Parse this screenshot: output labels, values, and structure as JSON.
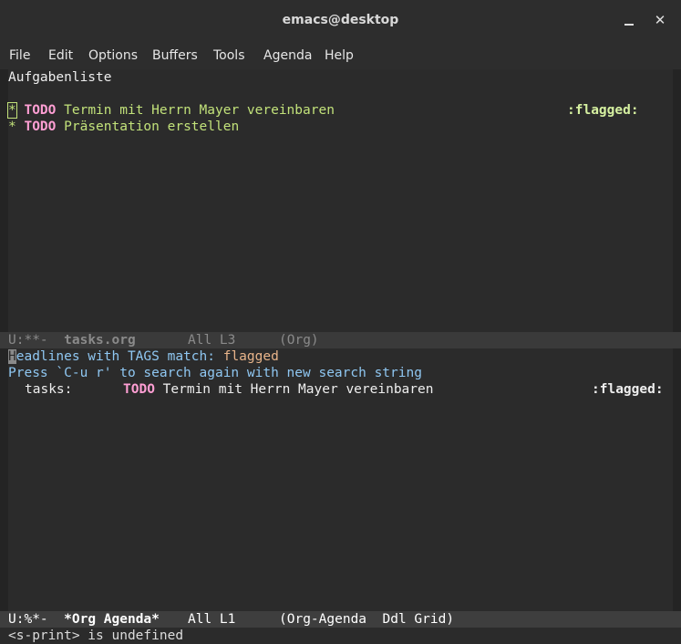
{
  "window": {
    "title": "emacs@desktop",
    "minimize_label": "",
    "close_label": "✕"
  },
  "menu": [
    "File",
    "Edit",
    "Options",
    "Buffers",
    "Tools",
    "Agenda",
    "Help"
  ],
  "top_buffer": {
    "heading": "Aufgabenliste",
    "items": [
      {
        "star": "*",
        "keyword": "TODO",
        "text": "Termin mit Herrn Mayer vereinbaren",
        "tag": ":flagged:"
      },
      {
        "star": "*",
        "keyword": "TODO",
        "text": "Präsentation erstellen",
        "tag": ""
      }
    ]
  },
  "top_modeline": {
    "status": "U:**-",
    "buffer": "tasks.org",
    "position": "All L3",
    "mode": "(Org)"
  },
  "agenda": {
    "header_cursor": "H",
    "header_rest": "eadlines with TAGS match: ",
    "header_match": "flagged",
    "hint": "Press `C-u r' to search again with new search string",
    "entries": [
      {
        "category": "tasks:",
        "keyword": "TODO",
        "text": "Termin mit Herrn Mayer vereinbaren",
        "tag": ":flagged:"
      }
    ]
  },
  "bottom_modeline": {
    "status": "U:%*-",
    "buffer": "*Org Agenda*",
    "position": "All L1",
    "mode": "(Org-Agenda  Ddl Grid)"
  },
  "minibuffer": "<s-print> is undefined"
}
